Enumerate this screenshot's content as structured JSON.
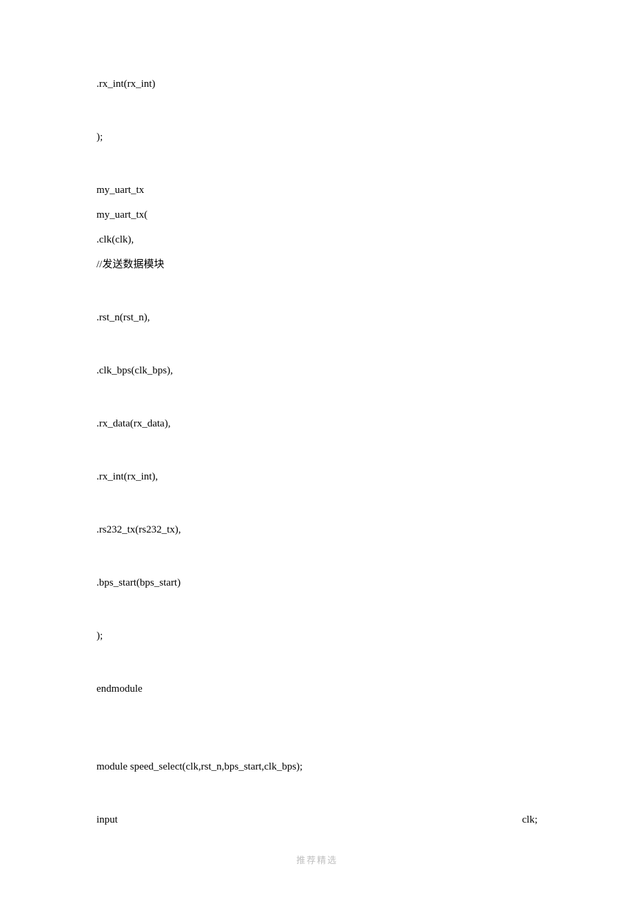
{
  "lines": {
    "l1": ".rx_int(rx_int)",
    "l2": ");",
    "l3": "my_uart_tx",
    "l4": "my_uart_tx(",
    "l5": ".clk(clk),",
    "l6": "//发送数据模块",
    "l7": ".rst_n(rst_n),",
    "l8": ".clk_bps(clk_bps),",
    "l9": ".rx_data(rx_data),",
    "l10": ".rx_int(rx_int),",
    "l11": ".rs232_tx(rs232_tx),",
    "l12": ".bps_start(bps_start)",
    "l13": ");",
    "l14": "endmodule",
    "l15": "module speed_select(clk,rst_n,bps_start,clk_bps);",
    "l16_left": "input",
    "l16_right": "clk;"
  },
  "footer": "推荐精选"
}
